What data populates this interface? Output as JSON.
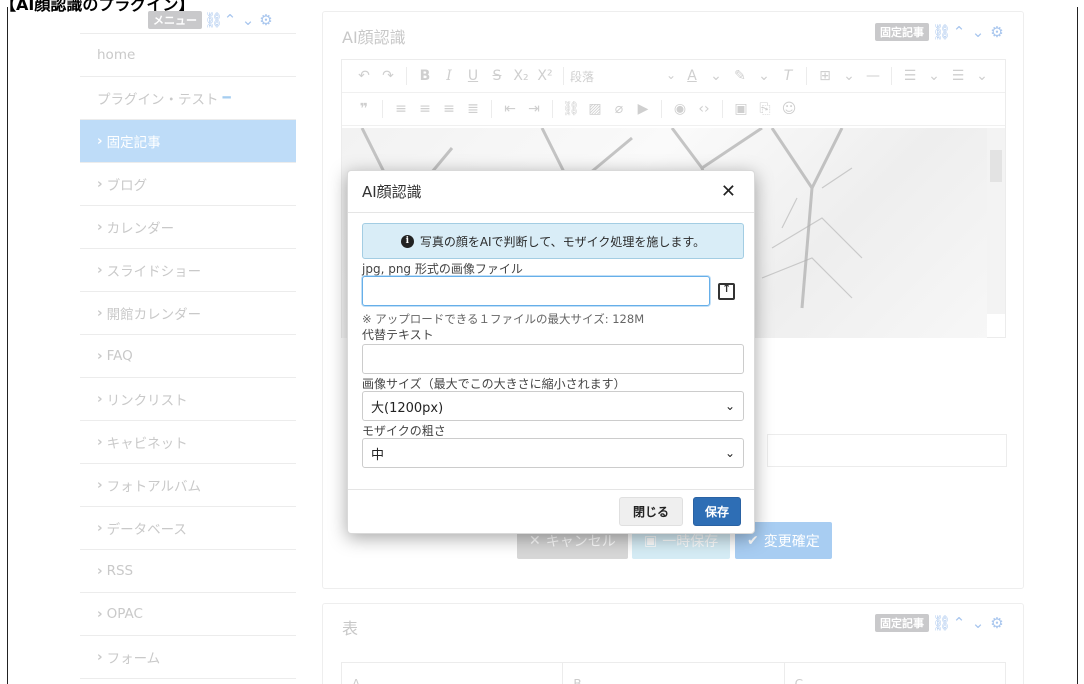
{
  "page": {
    "caption": "【AI顔認識のプラグイン】"
  },
  "menu_frame": {
    "badge": "メニュー"
  },
  "sidebar": {
    "items": [
      {
        "label": "home"
      },
      {
        "label": "プラグイン・テスト"
      },
      {
        "label": "固定記事"
      },
      {
        "label": "ブログ"
      },
      {
        "label": "カレンダー"
      },
      {
        "label": "スライドショー"
      },
      {
        "label": "開館カレンダー"
      },
      {
        "label": "FAQ"
      },
      {
        "label": "リンクリスト"
      },
      {
        "label": "キャビネット"
      },
      {
        "label": "フォトアルバム"
      },
      {
        "label": "データベース"
      },
      {
        "label": "RSS"
      },
      {
        "label": "OPAC"
      },
      {
        "label": "フォーム"
      }
    ]
  },
  "main_panel": {
    "title": "AI顔認識",
    "badge": "固定記事",
    "toolbar": {
      "paragraph_select": "段落"
    },
    "buttons": {
      "cancel": "キャンセル",
      "temp_save": "一時保存",
      "confirm": "変更確定"
    }
  },
  "second_panel": {
    "title": "表",
    "badge": "固定記事",
    "columns": [
      "A",
      "B",
      "C"
    ]
  },
  "modal": {
    "title": "AI顔認識",
    "info_text": "写真の顔をAIで判断して、モザイク処理を施します。",
    "file_label": "jpg, png 形式の画像ファイル",
    "file_value": "",
    "upload_note": "※ アップロードできる１ファイルの最大サイズ: 128M",
    "alt_label": "代替テキスト",
    "alt_value": "",
    "size_label": "画像サイズ（最大でこの大きさに縮小されます）",
    "size_value": "大(1200px)",
    "mosaic_label": "モザイクの粗さ",
    "mosaic_value": "中",
    "close_button": "閉じる",
    "save_button": "保存"
  },
  "colors": {
    "sidebar_active": "#bedcf8",
    "save_button": "#2e6eb5",
    "info_bg": "#d9edf7"
  }
}
